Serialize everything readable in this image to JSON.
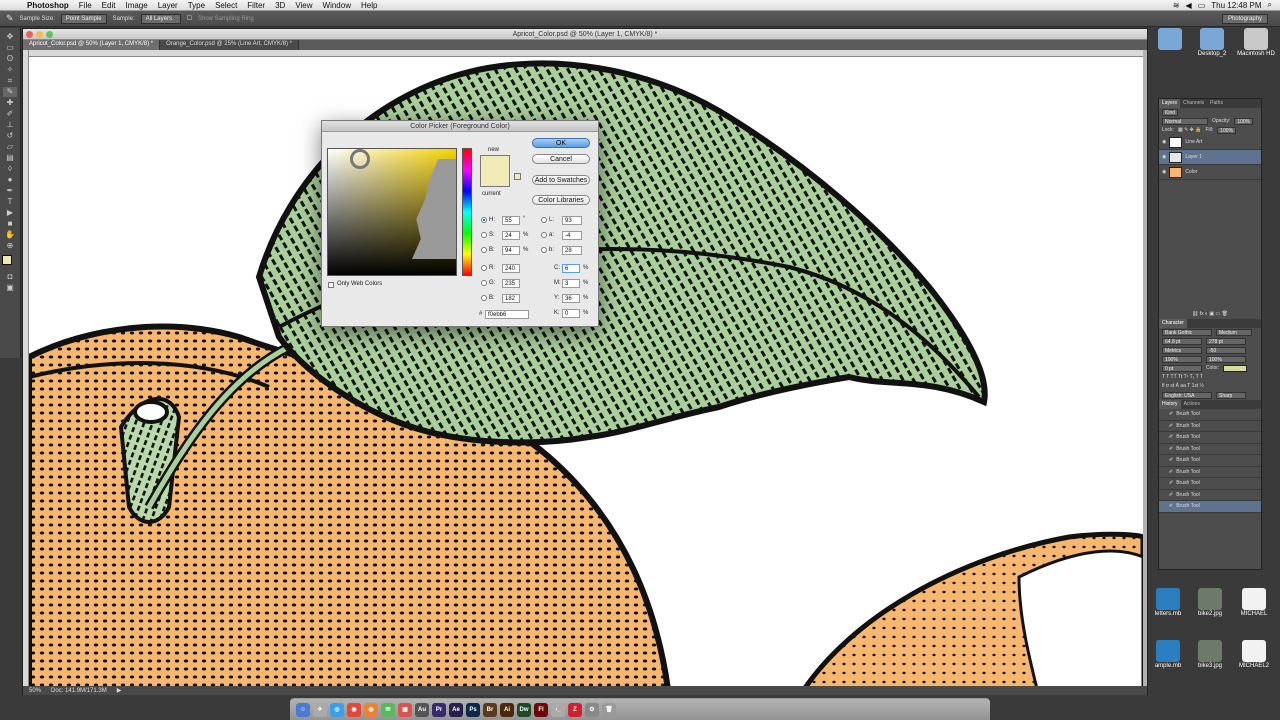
{
  "menubar": {
    "app": "Photoshop",
    "items": [
      "File",
      "Edit",
      "Image",
      "Layer",
      "Type",
      "Select",
      "Filter",
      "3D",
      "View",
      "Window",
      "Help"
    ],
    "clock": "Thu 12:48 PM"
  },
  "options": {
    "sample_size_label": "Sample Size:",
    "sample_size_value": "Point Sample",
    "sample_label": "Sample:",
    "sample_value": "All Layers",
    "show_ring": "Show Sampling Ring",
    "workspace": "Photography"
  },
  "document": {
    "title": "Apricot_Color.psd @ 50% (Layer 1, CMYK/8) *",
    "tabs": [
      "Apricot_Color.psd @ 50% (Layer 1, CMYK/8) *",
      "Orange_Color.psd @ 25% (Line Art, CMYK/8) *"
    ],
    "zoom": "50%",
    "doc_size": "Doc: 141.9M/171.3M"
  },
  "color_picker": {
    "title": "Color Picker (Foreground Color)",
    "ok": "OK",
    "cancel": "Cancel",
    "add_to_swatches": "Add to Swatches",
    "color_libraries": "Color Libraries",
    "new_label": "new",
    "current_label": "current",
    "only_web_colors": "Only Web Colors",
    "fields": {
      "H": "55",
      "S": "24",
      "B": "94",
      "R": "240",
      "G": "235",
      "Bv": "182",
      "L": "93",
      "a": "-4",
      "b": "28",
      "C": "6",
      "M": "3",
      "Y": "36",
      "K": "0"
    },
    "units": {
      "deg": "°",
      "pct": "%"
    },
    "hex_label": "#",
    "hex": "f0ebb6",
    "new_color": "#f0ebb6",
    "current_color": "#f0ebb6"
  },
  "panels": {
    "layers_tabs": [
      "Layers",
      "Channels",
      "Paths"
    ],
    "kind": "Kind",
    "blend_mode": "Normal",
    "opacity_label": "Opacity:",
    "opacity": "100%",
    "lock_label": "Lock:",
    "fill_label": "Fill:",
    "fill": "100%",
    "layers": [
      "Line Art",
      "Layer 1",
      "Color"
    ],
    "character_tab": "Character",
    "font_family": "Bank Gothic",
    "font_style": "Medium",
    "font_size": "64.8 pt",
    "leading": "278 pt",
    "kerning": "Metrics",
    "tracking": "-50",
    "vscale": "100%",
    "hscale": "100%",
    "baseline": "0 pt",
    "color_label": "Color:",
    "language": "English: USA",
    "aa": "Sharp",
    "history_tabs": [
      "History",
      "Actions"
    ],
    "history_item": "Brush Tool",
    "history_count": 9
  },
  "desktop_icons": [
    "Desktop_2",
    "Macintosh HD",
    "bike2.jpg",
    "MICHAEL",
    "bike3.jpg",
    "letters.mb",
    "ample.mb",
    "MICHAEL2"
  ],
  "dock_apps": [
    "Au",
    "Pr",
    "Ae",
    "Ps",
    "Br",
    "Ai",
    "Dw",
    "Fl"
  ],
  "colors": {
    "orange": "#f7b76e",
    "leaf": "#a9cf9a",
    "ink": "#111111"
  }
}
